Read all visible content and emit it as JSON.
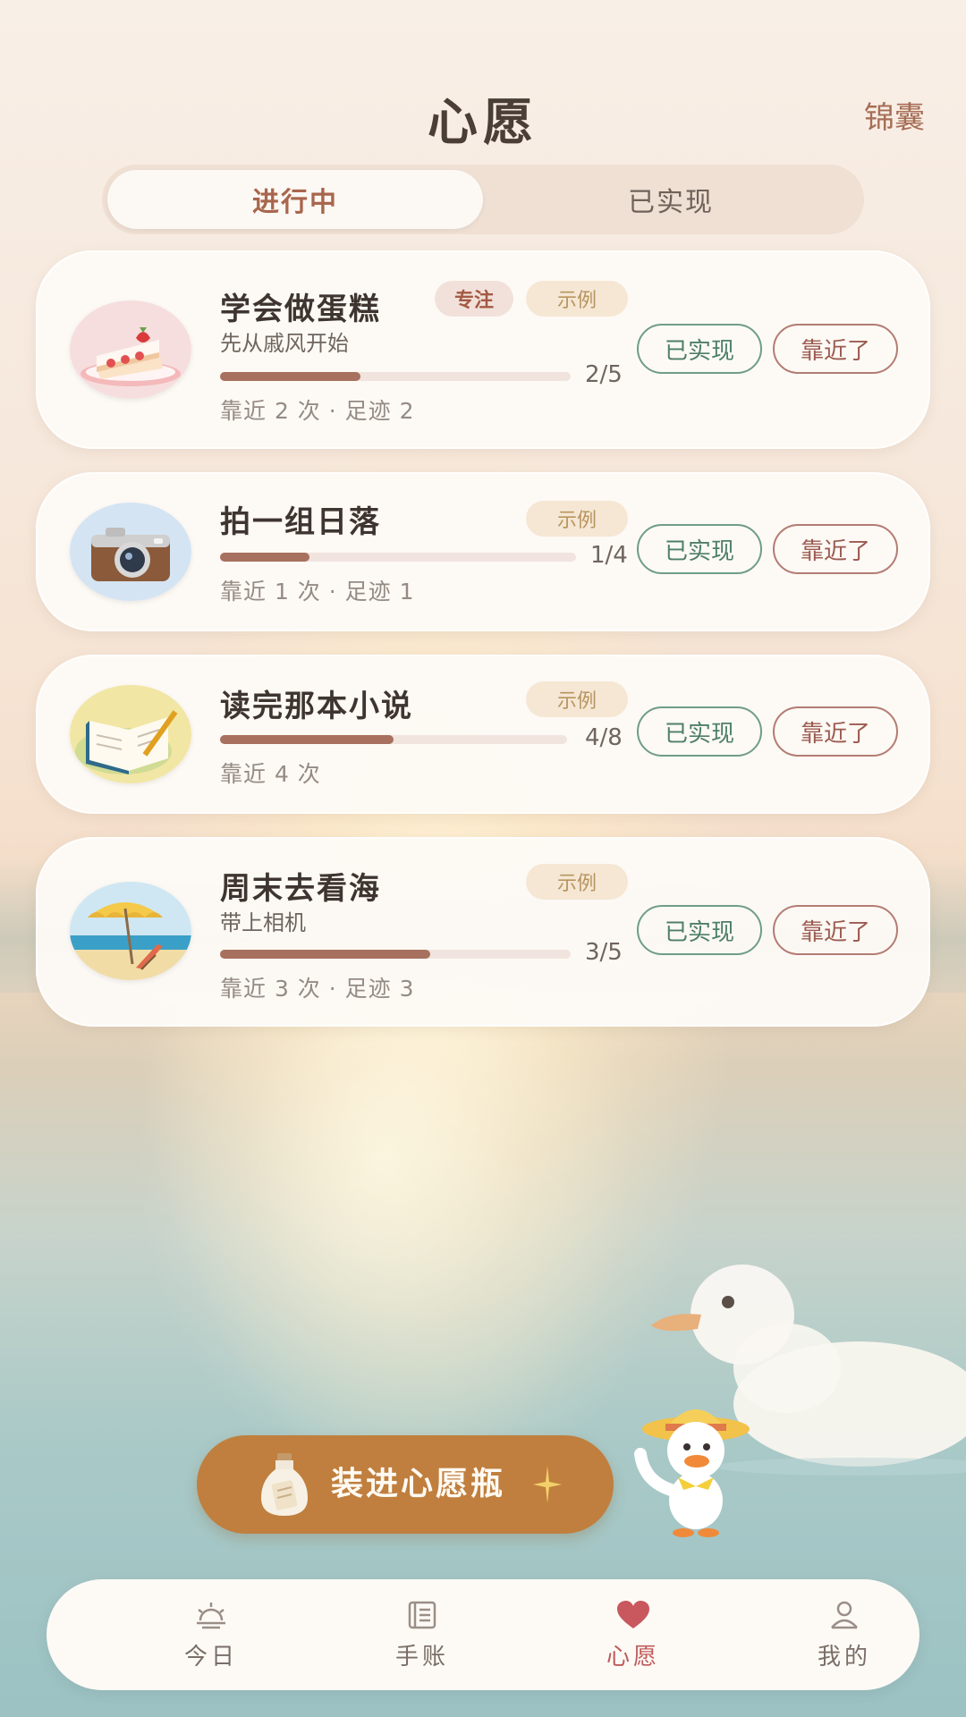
{
  "header": {
    "title": "心愿",
    "corner_link": "锦囊"
  },
  "tabs": [
    {
      "label": "进行中",
      "active": true
    },
    {
      "label": "已实现",
      "active": false
    }
  ],
  "wishes": [
    {
      "title": "学会做蛋糕",
      "focus_tag": "专注",
      "example_tag": "示例",
      "subtitle": "先从戚风开始",
      "progress": "2/5",
      "progress_fraction": 0.4,
      "meta": "靠近 2 次 · 足迹 2",
      "done_label": "已实现",
      "near_label": "靠近了",
      "icon": "cake-icon"
    },
    {
      "title": "拍一组日落",
      "example_tag": "示例",
      "progress": "1/4",
      "progress_fraction": 0.25,
      "meta": "靠近 1 次 · 足迹 1",
      "done_label": "已实现",
      "near_label": "靠近了",
      "icon": "camera-icon"
    },
    {
      "title": "读完那本小说",
      "example_tag": "示例",
      "progress": "4/8",
      "progress_fraction": 0.5,
      "meta": "靠近 4 次",
      "done_label": "已实现",
      "near_label": "靠近了",
      "icon": "book-icon"
    },
    {
      "title": "周末去看海",
      "example_tag": "示例",
      "subtitle": "带上相机",
      "progress": "3/5",
      "progress_fraction": 0.6,
      "meta": "靠近 3 次 · 足迹 3",
      "done_label": "已实现",
      "near_label": "靠近了",
      "icon": "beach-umbrella-icon"
    }
  ],
  "cta": {
    "label": "装进心愿瓶",
    "icon": "wish-bottle-icon"
  },
  "nav": [
    {
      "label": "今日",
      "icon": "sunrise-icon",
      "active": false
    },
    {
      "label": "手账",
      "icon": "journal-icon",
      "active": false
    },
    {
      "label": "心愿",
      "icon": "heart-icon",
      "active": true
    },
    {
      "label": "我的",
      "icon": "user-icon",
      "active": false
    }
  ],
  "colors": {
    "accent": "#c07f3e",
    "progress": "#a8705e",
    "done_green": "#6f9d86",
    "near_red": "#b37c73",
    "nav_active": "#bf5a5a"
  }
}
